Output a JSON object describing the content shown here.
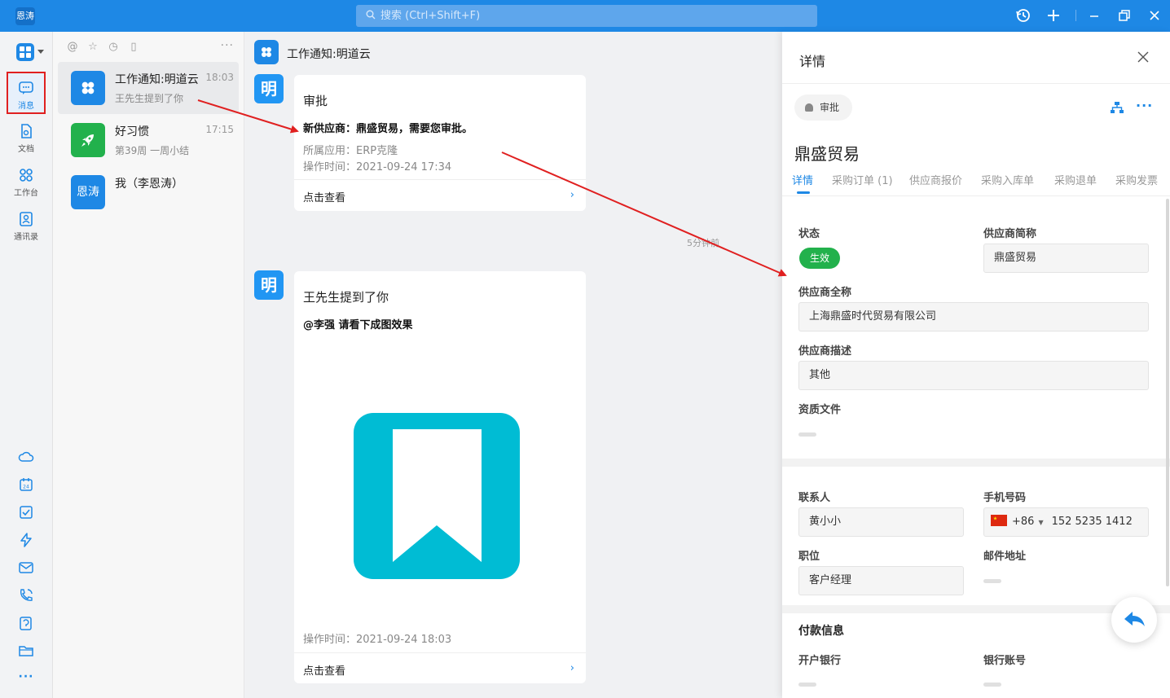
{
  "app": {
    "logo_text": "恩涛",
    "accent": "#1e88e5",
    "annotation_color": "#e02020"
  },
  "topbar": {
    "search_placeholder": "搜索 (Ctrl+Shift+F)",
    "icons": [
      "history-icon",
      "add-icon",
      "minimize-icon",
      "restore-icon",
      "close-icon"
    ]
  },
  "leftnav": {
    "items": [
      {
        "label": "消息",
        "icon": "message-icon",
        "active": true
      },
      {
        "label": "文档",
        "icon": "document-icon",
        "active": false
      },
      {
        "label": "工作台",
        "icon": "workbench-icon",
        "active": false
      },
      {
        "label": "通讯录",
        "icon": "contacts-icon",
        "active": false
      }
    ],
    "bottom_icons": [
      "cloud-icon",
      "calendar-24-icon",
      "task-check-icon",
      "lightning-icon",
      "mail-icon",
      "call-icon",
      "knowledge-icon",
      "folder-icon",
      "more-icon"
    ]
  },
  "convlist": {
    "tool_icons": [
      "at-icon",
      "star-icon",
      "clock-icon",
      "archive-icon"
    ],
    "items": [
      {
        "title": "工作通知:明道云",
        "subtitle": "王先生提到了你",
        "time": "18:03",
        "avatar_color": "#1e88e5",
        "selected": true
      },
      {
        "title": "好习惯",
        "subtitle": "第39周 一周小结",
        "time": "17:15",
        "avatar_color": "#22b14c",
        "selected": false
      },
      {
        "title": "我（李恩涛）",
        "subtitle": "",
        "time": "",
        "avatar_color": "#1e88e5",
        "avatar_text": "恩涛",
        "selected": false
      }
    ]
  },
  "chat": {
    "header_title": "工作通知:明道云",
    "avatar_text": "明",
    "messages": [
      {
        "title": "审批",
        "bold_line": "新供应商：鼎盛贸易，需要您审批。",
        "meta1": "所属应用：ERP克隆",
        "meta2": "操作时间：2021-09-24 17:34",
        "link": "点击查看"
      },
      {
        "title": "王先生提到了你",
        "bold_line": "@李强 请看下成图效果",
        "meta1": "操作时间：2021-09-24 18:03",
        "link": "点击查看"
      }
    ],
    "separator_time": "5分钟前"
  },
  "detail": {
    "header_title": "详情",
    "chip_label": "审批",
    "record_name": "鼎盛贸易",
    "tabs": [
      "详情",
      "采购订单 (1)",
      "供应商报价",
      "采购入库单",
      "采购退单",
      "采购发票"
    ],
    "fields": {
      "status_label": "状态",
      "status_value": "生效",
      "short_name_label": "供应商简称",
      "short_name_value": "鼎盛贸易",
      "full_name_label": "供应商全称",
      "full_name_value": "上海鼎盛时代贸易有限公司",
      "desc_label": "供应商描述",
      "desc_value": "其他",
      "files_label": "资质文件",
      "contact_label": "联系人",
      "contact_value": "黄小小",
      "phone_label": "手机号码",
      "phone_code": "+86",
      "phone_value": "152 5235 1412",
      "position_label": "职位",
      "position_value": "客户经理",
      "email_label": "邮件地址",
      "payment_section": "付款信息",
      "bank_label": "开户银行",
      "account_label": "银行账号"
    },
    "status_color": "#22b14c"
  }
}
